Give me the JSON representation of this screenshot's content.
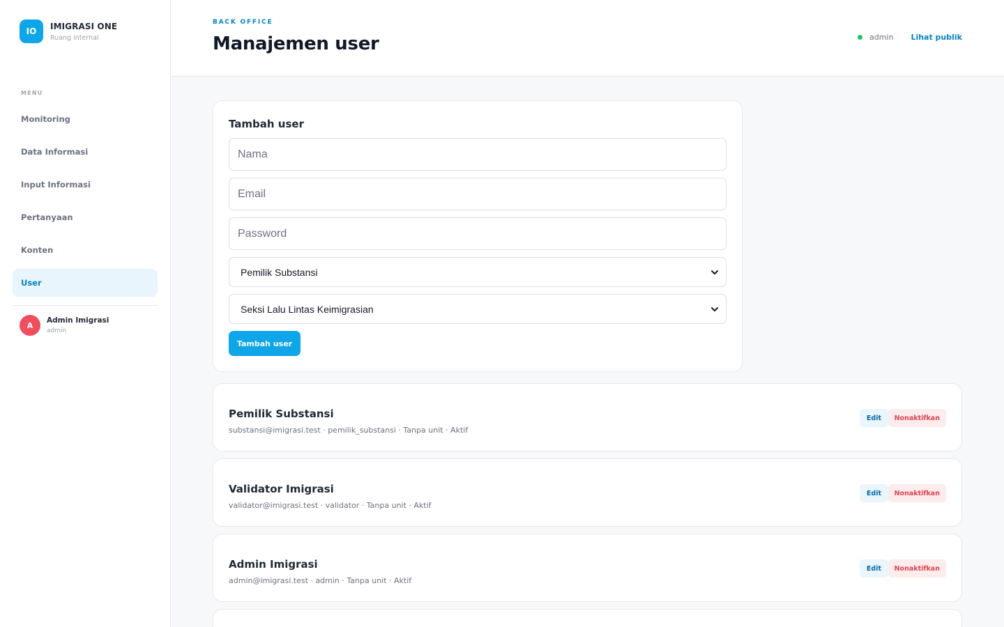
{
  "brand": {
    "logo": "IO",
    "title": "IMIGRASI ONE",
    "subtitle": "Ruang internal"
  },
  "sidebar": {
    "menu_label": "MENU",
    "items": [
      {
        "label": "Monitoring",
        "active": false
      },
      {
        "label": "Data Informasi",
        "active": false
      },
      {
        "label": "Input Informasi",
        "active": false
      },
      {
        "label": "Pertanyaan",
        "active": false
      },
      {
        "label": "Konten",
        "active": false
      },
      {
        "label": "User",
        "active": true
      }
    ],
    "profile": {
      "initial": "A",
      "name": "Admin Imigrasi",
      "role": "admin"
    }
  },
  "header": {
    "eyebrow": "BACK OFFICE",
    "title": "Manajemen user",
    "user": "admin",
    "public_link": "Lihat publik",
    "status_color": "#22c55e"
  },
  "form": {
    "title": "Tambah user",
    "name_placeholder": "Nama",
    "email_placeholder": "Email",
    "password_placeholder": "Password",
    "role_selected": "Pemilik Substansi",
    "unit_selected": "Seksi Lalu Lintas Keimigrasian",
    "submit_label": "Tambah user"
  },
  "users": [
    {
      "name": "Pemilik Substansi",
      "meta": "substansi@imigrasi.test · pemilik_substansi · Tanpa unit · Aktif"
    },
    {
      "name": "Validator Imigrasi",
      "meta": "validator@imigrasi.test · validator · Tanpa unit · Aktif"
    },
    {
      "name": "Admin Imigrasi",
      "meta": "admin@imigrasi.test · admin · Tanpa unit · Aktif"
    }
  ],
  "actions": {
    "edit_label": "Edit",
    "deactivate_label": "Nonaktifkan"
  },
  "colors": {
    "accent": "#0ea5e9",
    "danger": "#dc4452",
    "avatar": "#ef4e5f"
  }
}
